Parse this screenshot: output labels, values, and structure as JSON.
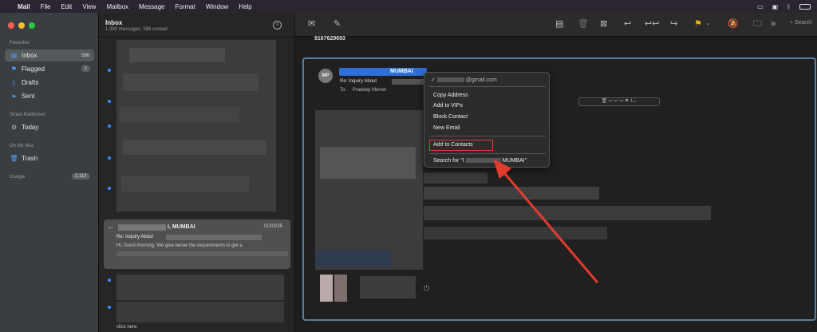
{
  "menubar": {
    "app": "Mail",
    "items": [
      "File",
      "Edit",
      "View",
      "Mailbox",
      "Message",
      "Format",
      "Window",
      "Help"
    ]
  },
  "sidebar": {
    "favorites_header": "Favorites",
    "items": [
      {
        "label": "Inbox",
        "count": "586"
      },
      {
        "label": "Flagged",
        "count": "1"
      },
      {
        "label": "Drafts"
      },
      {
        "label": "Sent"
      }
    ],
    "smart_header": "Smart Mailboxes",
    "today": "Today",
    "onmymac_header": "On My Mac",
    "trash": "Trash",
    "google_header": "Google",
    "google_count": "2,113"
  },
  "list": {
    "title": "Inbox",
    "subtitle": "1,390 messages, 586 unread",
    "selected": {
      "from": "I, MUMBAI",
      "date": "01/03/25",
      "subject": "Re: Inquiry About",
      "preview": "Hi, Good morning, We give below the requirements to get a"
    },
    "click_here": "click here."
  },
  "toolbar": {
    "search": "Search"
  },
  "reading": {
    "phone": "9167629693",
    "avatar": "MP",
    "sender": "MUMBAI",
    "subject": "Re: Inquiry About",
    "to_label": "To:",
    "to_name": "Pradeep Menon"
  },
  "context_menu": {
    "email": "@gmail.com",
    "items": [
      "Copy Address",
      "Add to VIPs",
      "Block Contact",
      "New Email"
    ],
    "add_to_contacts": "Add to Contacts",
    "search_prefix": "Search for \"I",
    "search_suffix": "MUMBAI\""
  },
  "colors": {
    "accent": "#2e6fd8",
    "unread_dot": "#3b8cff",
    "annotation": "#e23b2e",
    "flag": "#f2b01e"
  }
}
